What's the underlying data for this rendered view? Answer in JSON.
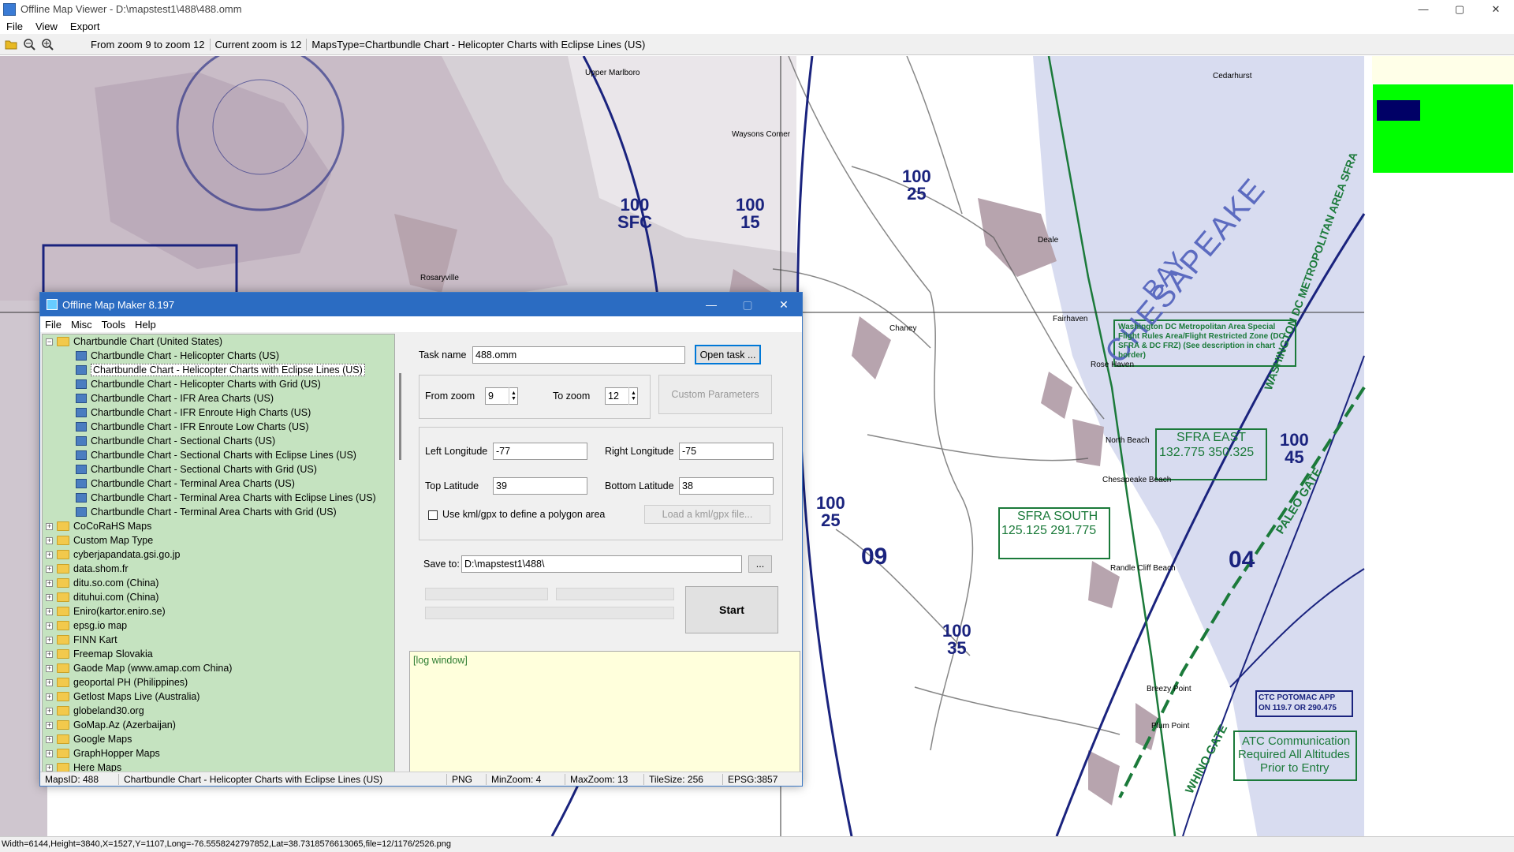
{
  "window": {
    "title": "Offline Map Viewer - D:\\mapstest1\\488\\488.omm",
    "min": "—",
    "max": "▢",
    "close": "✕"
  },
  "menu": [
    "File",
    "View",
    "Export"
  ],
  "toolbar": {
    "zoom_range": "From zoom 9 to zoom 12",
    "current_zoom": "Current zoom is 12",
    "maps_type": "MapsType=Chartbundle Chart - Helicopter Charts with Eclipse Lines (US)"
  },
  "map_labels": {
    "chesapeake": "CHESAPEAKE",
    "bay": "BAY",
    "sfra_east_title": "SFRA EAST",
    "sfra_east_freq": "132.775  350.325",
    "sfra_south_title": "SFRA SOUTH",
    "sfra_south_freq": "125.125  291.775",
    "ctc": "CTC POTOMAC APP\nON 119.7 OR 290.475",
    "atc1": "ATC Communication",
    "atc2": "Required All Altitudes",
    "atc3": "Prior to Entry",
    "dc_special": "Washington DC Metropolitan Area Special Flight Rules Area/Flight Restricted Zone (DC SFRA & DC FRZ) (See description in chart border)",
    "wash_metro": "WASHINGTON DC METROPOLITAN AREA SFRA",
    "paleo_gate": "PALEO GATE",
    "whino_gate": "WHINO GATE",
    "alt_100_15": [
      "100",
      "15"
    ],
    "alt_100_25": [
      "100",
      "25"
    ],
    "alt_100_45": [
      "100",
      "45"
    ],
    "alt_100_35": [
      "100",
      "35"
    ],
    "alt_100_sfc": [
      "100",
      "SFC"
    ],
    "n09": "09",
    "n04": "04",
    "places": [
      "Cedarhurst",
      "Waysons Corner",
      "Chaney",
      "Fairhaven",
      "Rose Haven",
      "North Beach",
      "Chesapeake Beach",
      "Randle Cliff Beach",
      "Breezy Point",
      "Plum Point",
      "Deale",
      "Upper Marlboro",
      "Rosaryville"
    ]
  },
  "dialog": {
    "title": "Offline Map Maker 8.197",
    "menu": [
      "File",
      "Misc",
      "Tools",
      "Help"
    ],
    "tree": {
      "root": "Chartbundle Chart (United States)",
      "children": [
        "Chartbundle Chart - Helicopter Charts (US)",
        "Chartbundle Chart - Helicopter Charts with Eclipse Lines (US)",
        "Chartbundle Chart - Helicopter Charts with Grid (US)",
        "Chartbundle Chart - IFR Area Charts (US)",
        "Chartbundle Chart - IFR Enroute High Charts (US)",
        "Chartbundle Chart - IFR Enroute Low Charts (US)",
        "Chartbundle Chart - Sectional Charts (US)",
        "Chartbundle Chart - Sectional Charts with Eclipse Lines (US)",
        "Chartbundle Chart - Sectional Charts with Grid (US)",
        "Chartbundle Chart - Terminal Area Charts (US)",
        "Chartbundle Chart - Terminal Area Charts with Eclipse Lines (US)",
        "Chartbundle Chart - Terminal Area Charts with Grid (US)"
      ],
      "folders": [
        "CoCoRaHS Maps",
        "Custom Map Type",
        "cyberjapandata.gsi.go.jp",
        "data.shom.fr",
        "ditu.so.com (China)",
        "dituhui.com (China)",
        "Eniro(kartor.eniro.se)",
        "epsg.io map",
        "FINN Kart",
        "Freemap Slovakia",
        "Gaode Map (www.amap.com China)",
        "geoportal PH (Philippines)",
        "Getlost Maps Live (Australia)",
        "globeland30.org",
        "GoMap.Az (Azerbaijan)",
        "Google Maps",
        "GraphHopper Maps",
        "Here Maps"
      ]
    },
    "task_name_label": "Task name",
    "task_name": "488.omm",
    "open_task": "Open task ...",
    "from_zoom_label": "From zoom",
    "from_zoom": "9",
    "to_zoom_label": "To zoom",
    "to_zoom": "12",
    "custom_params": "Custom Parameters",
    "left_lon_label": "Left Longitude",
    "left_lon": "-77",
    "right_lon_label": "Right Longitude",
    "right_lon": "-75",
    "top_lat_label": "Top Latitude",
    "top_lat": "39",
    "bottom_lat_label": "Bottom Latitude",
    "bottom_lat": "38",
    "kml_label": "Use kml/gpx to define a polygon area",
    "load_kml": "Load a kml/gpx file...",
    "save_to_label": "Save to:",
    "save_to": "D:\\mapstest1\\488\\",
    "browse": "...",
    "start": "Start",
    "log": "[log window]",
    "status": {
      "mapsid": "MapsID: 488",
      "name": "Chartbundle Chart - Helicopter Charts with Eclipse Lines (US)",
      "format": "PNG",
      "minzoom": "MinZoom: 4",
      "maxzoom": "MaxZoom: 13",
      "tilesize": "TileSize: 256",
      "epsg": "EPSG:3857"
    }
  },
  "statusbar": "Width=6144,Height=3840,X=1527,Y=1107,Long=-76.5558242797852,Lat=38.7318576613065,file=12/1176/2526.png"
}
